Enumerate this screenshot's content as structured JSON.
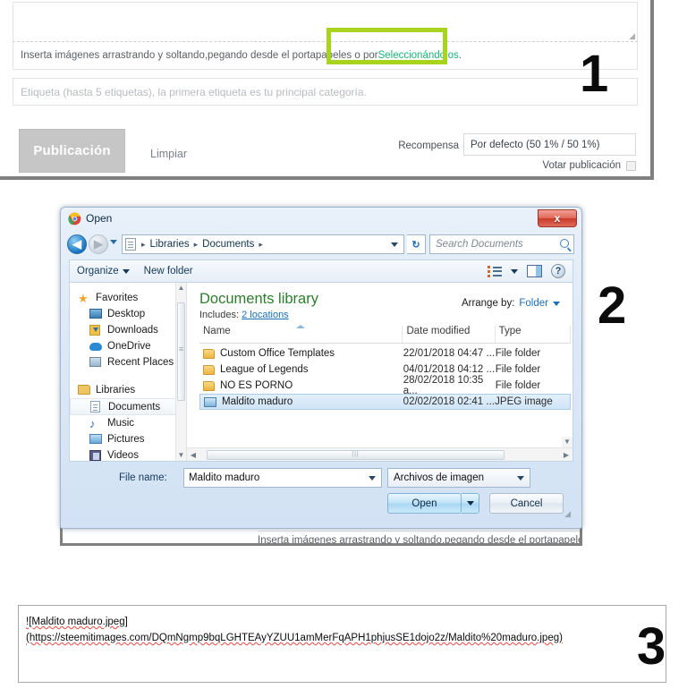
{
  "annotations": {
    "step1": "1",
    "step2": "2",
    "step3": "3"
  },
  "highlight_color": "#a8d420",
  "accent_link_color": "#19b37a",
  "editor": {
    "body_placeholder": "",
    "insert_hint_prefix": "Inserta imágenes arrastrando y soltando,pegando desde el portapapeles o por ",
    "insert_hint_link": "Seleccionándolos",
    "insert_hint_suffix": ".",
    "tag_placeholder": "Etiqueta (hasta 5 etiquetas), la primera etiqueta es tu principal categoría.",
    "publish_label": "Publicación",
    "clear_label": "Limpiar",
    "reward_label": "Recompensa",
    "reward_value": "Por defecto (50 1% / 50 1%)",
    "vote_label": "Votar publicación",
    "resize_glyph": "◢"
  },
  "behind": {
    "hint_text": "Inserta imágenes arrastrando y soltando,pegando desde el portapapeles o"
  },
  "dialog": {
    "title": "Open",
    "app_icon": "chrome-icon",
    "close_label": "x",
    "nav": {
      "back_glyph": "◀",
      "forward_glyph": "▶",
      "recent_dropdown": "history-dropdown-icon",
      "refresh_glyph": "↻"
    },
    "breadcrumb": [
      "Libraries",
      "Documents"
    ],
    "breadcrumb_sep": "▸",
    "search_placeholder": "Search Documents",
    "toolbar": {
      "organize_label": "Organize",
      "new_folder_label": "New folder",
      "views_icon": "view-options-icon",
      "preview_icon": "preview-pane-icon",
      "help_icon": "help-icon",
      "help_glyph": "?"
    },
    "nav_pane": [
      {
        "label": "Favorites",
        "icon": "star-icon",
        "level": 0,
        "selected": false
      },
      {
        "label": "Desktop",
        "icon": "desktop-icon",
        "level": 1,
        "selected": false
      },
      {
        "label": "Downloads",
        "icon": "downloads-icon",
        "level": 1,
        "selected": false
      },
      {
        "label": "OneDrive",
        "icon": "onedrive-cloud-icon",
        "level": 1,
        "selected": false
      },
      {
        "label": "Recent Places",
        "icon": "recent-places-icon",
        "level": 1,
        "selected": false
      },
      {
        "label": "Libraries",
        "icon": "libraries-icon",
        "level": 0,
        "selected": false
      },
      {
        "label": "Documents",
        "icon": "documents-icon",
        "level": 1,
        "selected": true
      },
      {
        "label": "Music",
        "icon": "music-note-icon",
        "level": 1,
        "selected": false
      },
      {
        "label": "Pictures",
        "icon": "pictures-icon",
        "level": 1,
        "selected": false
      },
      {
        "label": "Videos",
        "icon": "videos-icon",
        "level": 1,
        "selected": false
      }
    ],
    "library": {
      "title": "Documents library",
      "includes_label": "Includes:",
      "includes_value": "2 locations",
      "arrange_label": "Arrange by:",
      "arrange_value": "Folder"
    },
    "columns": [
      "Name",
      "Date modified",
      "Type"
    ],
    "files": [
      {
        "name": "Custom Office Templates",
        "date": "22/01/2018 04:47 ...",
        "type": "File folder",
        "icon": "folder-icon",
        "selected": false
      },
      {
        "name": "League of Legends",
        "date": "04/01/2018 04:12 ...",
        "type": "File folder",
        "icon": "folder-icon",
        "selected": false
      },
      {
        "name": "NO ES PORNO",
        "date": "28/02/2018 10:35 a...",
        "type": "File folder",
        "icon": "folder-icon",
        "selected": false
      },
      {
        "name": "Maldito maduro",
        "date": "02/02/2018 02:41 ...",
        "type": "JPEG image",
        "icon": "jpeg-image-icon",
        "selected": true
      }
    ],
    "footer": {
      "file_name_label": "File name:",
      "file_name_value": "Maldito maduro",
      "filter_value": "Archivos de imagen",
      "open_label": "Open",
      "cancel_label": "Cancel"
    }
  },
  "result": {
    "line1": "![Maldito maduro.jpeg]",
    "line2": "(https://steemitimages.com/DQmNgmp9bqLGHTEAyYZUU1amMerFqAPH1phjusSE1dojo2z/Maldito%20maduro.jpeg)",
    "alt_text": "Maldito maduro.jpeg",
    "url": "https://steemitimages.com/DQmNgmp9bqLGHTEAyYZUU1amMerFqAPH1phjusSE1dojo2z/Maldito%20maduro.jpeg",
    "ipfs_hash": "DQmNgmp9bqLGHTEAyYZUU1amMerFqAPH1phjusSE1dojo2z",
    "file_part": "Maldito%20maduro.jpeg"
  }
}
